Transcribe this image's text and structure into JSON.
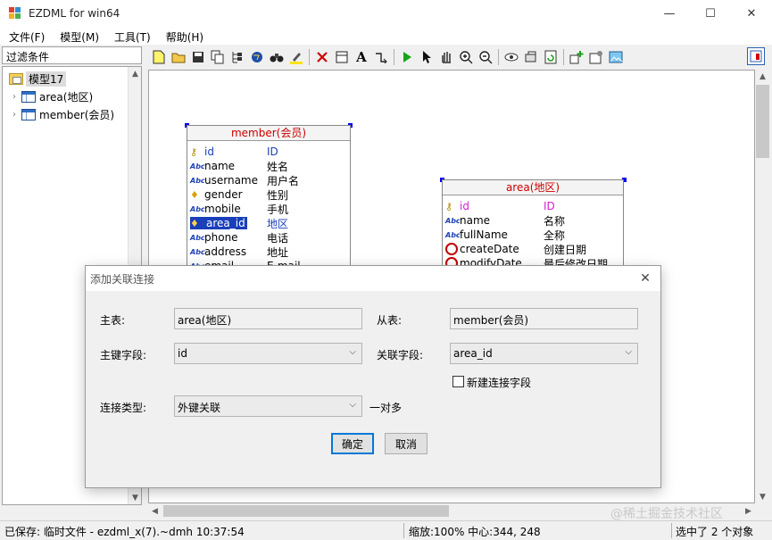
{
  "window": {
    "title": "EZDML for win64",
    "minimize_glyph": "—",
    "maximize_glyph": "☐",
    "close_glyph": "✕"
  },
  "menu": [
    "文件(F)",
    "模型(M)",
    "工具(T)",
    "帮助(H)"
  ],
  "left_panel": {
    "filter_label": "过滤条件",
    "tree": {
      "root": "模型17",
      "children": [
        "area(地区)",
        "member(会员)"
      ]
    }
  },
  "toolbar": {
    "icons": [
      "new-file-icon",
      "open-folder-icon",
      "save-icon",
      "copy-icon",
      "tree-icon",
      "globe-icon",
      "binoculars-icon",
      "highlight-icon",
      "delete-icon",
      "table-icon",
      "text-icon",
      "link-icon",
      "run-icon",
      "pointer-icon",
      "hand-icon",
      "zoom-in-icon",
      "zoom-out-icon",
      "eye-icon",
      "refresh-icon",
      "export-icon",
      "settings-icon",
      "picture-icon",
      "toggle-panel-icon"
    ]
  },
  "diagram": {
    "member": {
      "title": "member(会员)",
      "fields": [
        {
          "name": "id",
          "caption": "ID",
          "icon": "key-icon"
        },
        {
          "name": "name",
          "caption": "姓名",
          "icon": "text-field-icon"
        },
        {
          "name": "username",
          "caption": "用户名",
          "icon": "text-field-icon"
        },
        {
          "name": "gender",
          "caption": "性别",
          "icon": "bulb-icon"
        },
        {
          "name": "mobile",
          "caption": "手机",
          "icon": "text-field-icon"
        },
        {
          "name": "area_id",
          "caption": "地区",
          "icon": "bulb-icon"
        },
        {
          "name": "phone",
          "caption": "电话",
          "icon": "text-field-icon"
        },
        {
          "name": "address",
          "caption": "地址",
          "icon": "text-field-icon"
        },
        {
          "name": "email",
          "caption": "E-mail",
          "icon": "text-field-icon"
        }
      ]
    },
    "area": {
      "title": "area(地区)",
      "fields": [
        {
          "name": "id",
          "caption": "ID",
          "icon": "key-icon"
        },
        {
          "name": "name",
          "caption": "名称",
          "icon": "text-field-icon"
        },
        {
          "name": "fullName",
          "caption": "全称",
          "icon": "text-field-icon"
        },
        {
          "name": "createDate",
          "caption": "创建日期",
          "icon": "clock-icon"
        },
        {
          "name": "modifyDate",
          "caption": "最后修改日期",
          "icon": "clock-icon"
        }
      ]
    },
    "text_field_icon_glyph": "Abc"
  },
  "dialog": {
    "title": "添加关联连接",
    "master_table_label": "主表:",
    "master_table_value": "area(地区)",
    "detail_table_label": "从表:",
    "detail_table_value": "member(会员)",
    "pk_field_label": "主键字段:",
    "pk_field_value": "id",
    "fk_field_label": "关联字段:",
    "fk_field_value": "area_id",
    "new_link_field_label": "新建连接字段",
    "new_link_field_checked": false,
    "link_type_label": "连接类型:",
    "link_type_value": "外键关联",
    "link_type_note": "一对多",
    "ok_button": "确定",
    "cancel_button": "取消"
  },
  "statusbar": {
    "saved": "已保存: 临时文件 - ezdml_x(7).~dmh 10:37:54",
    "zoom": "缩放:100% 中心:344, 248",
    "selection": "选中了 2 个对象"
  },
  "watermark": "@稀土掘金技术社区"
}
